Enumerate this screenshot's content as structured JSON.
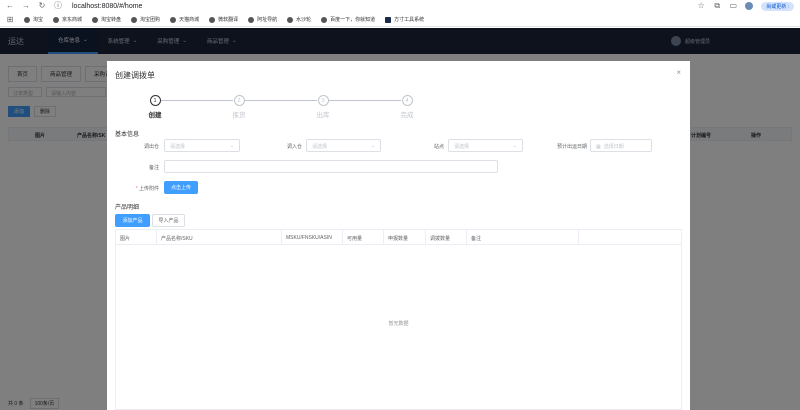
{
  "browser": {
    "url": "localhost:8080/#/home",
    "update_label": "尚或更新 :",
    "bookmarks": [
      "淘宝",
      "京东商城",
      "淘宝转盘",
      "淘宝团购",
      "天猫商城",
      "微软翻译",
      "阿址导航",
      "水沙轮",
      "百度一下，你就知道",
      "方寸工具系统"
    ]
  },
  "app": {
    "logo": "运达",
    "menu": [
      "仓库信息",
      "系统管理",
      "采购管理",
      "商品管理"
    ],
    "user_name": "超级管理员"
  },
  "background_page": {
    "tabs": [
      "首页",
      "商品管理",
      "采购计"
    ],
    "filters": [
      "订单类型",
      "请输入内容"
    ],
    "add_label": "添加",
    "delete_label": "删除",
    "table_headers": [
      "图片",
      "产品名称/SK",
      "计划编号",
      "操作"
    ],
    "footer_total": "共 0 条",
    "footer_page_size": "100条/页"
  },
  "dialog": {
    "title": "创建调拨单",
    "steps": [
      {
        "num": "1",
        "label": "创建",
        "active": true
      },
      {
        "num": "2",
        "label": "拣货",
        "active": false
      },
      {
        "num": "3",
        "label": "出库",
        "active": false
      },
      {
        "num": "4",
        "label": "完成",
        "active": false
      }
    ],
    "basic_info_title": "基本信息",
    "fields": {
      "out_warehouse_label": "调出仓",
      "out_warehouse_placeholder": "请选择",
      "in_warehouse_label": "调入仓",
      "in_warehouse_placeholder": "请选择",
      "site_label": "站点",
      "site_placeholder": "请选择",
      "ship_date_label": "预计出运日期",
      "ship_date_placeholder": "选择日期",
      "remark_label": "备注",
      "remark_value": "",
      "attachment_label": "上传附件",
      "upload_label": "点击上传"
    },
    "product_detail_title": "产品明细",
    "add_product_label": "添加产品",
    "import_product_label": "导入产品",
    "product_table": {
      "headers": [
        "图片",
        "产品名称/SKU",
        "MSKU/FNSKU/ASIN",
        "可用量",
        "申报数量",
        "调拨数量",
        "备注"
      ],
      "empty_text": "暂无数据"
    }
  }
}
